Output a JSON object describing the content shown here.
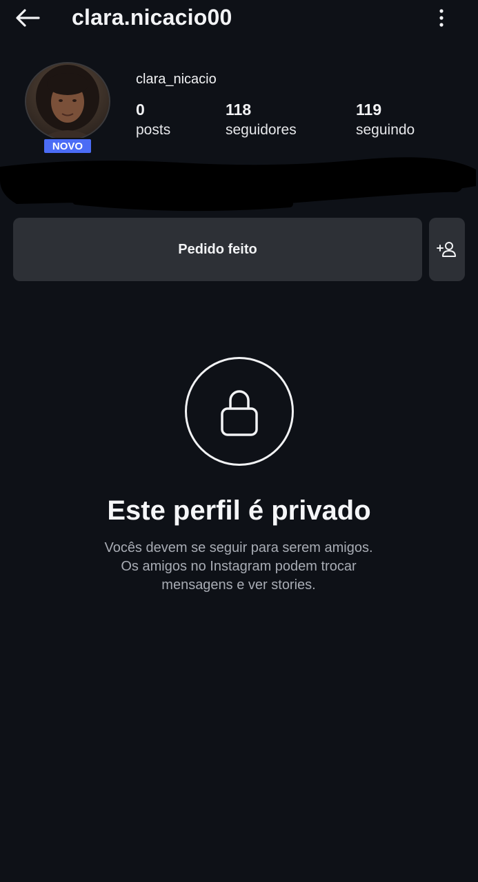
{
  "header": {
    "username": "clara.nicacio00",
    "back_icon": "arrow-left-icon",
    "more_icon": "more-vertical-icon"
  },
  "profile": {
    "display_name": "clara_nicacio",
    "badge": "NOVO",
    "stats": [
      {
        "count": "0",
        "label": "posts"
      },
      {
        "count": "118",
        "label": "seguidores"
      },
      {
        "count": "119",
        "label": "seguindo"
      }
    ]
  },
  "actions": {
    "request_label": "Pedido feito",
    "suggest_icon": "add-person-icon"
  },
  "private": {
    "icon": "lock-icon",
    "title": "Este perfil é privado",
    "desc_line1": "Vocês devem se seguir para serem amigos.",
    "desc_line2": "Os amigos no Instagram podem trocar",
    "desc_line3": "mensagens e ver stories."
  },
  "colors": {
    "background": "#0e1117",
    "button": "#2d3036",
    "badge": "#4b6cf5",
    "muted_text": "#a8acb4"
  }
}
